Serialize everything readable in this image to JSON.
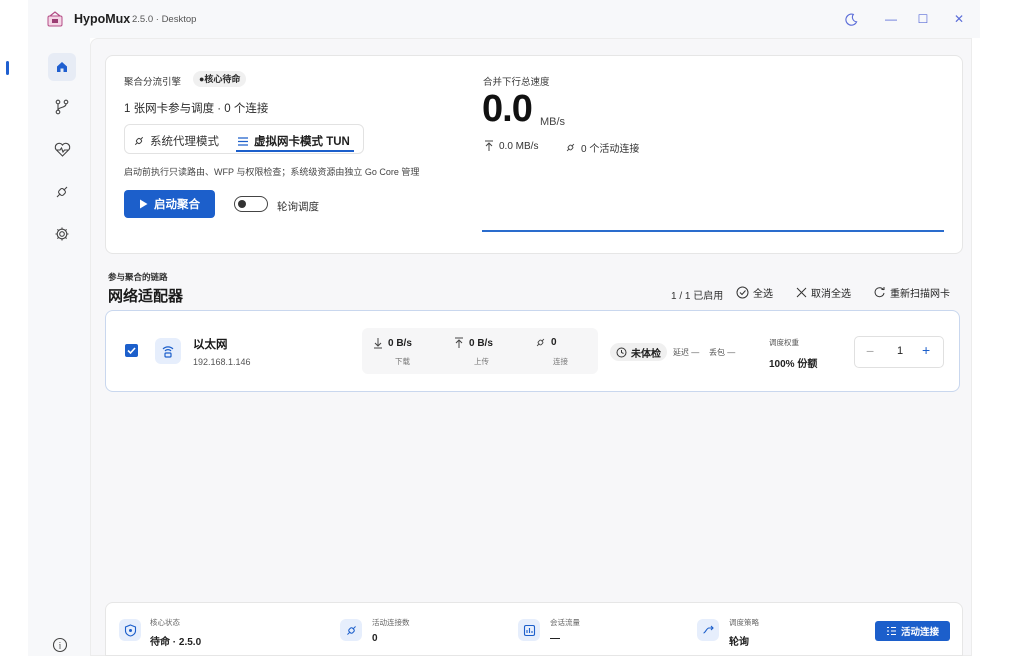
{
  "window": {
    "app_name": "HypoMux",
    "version": "2.5.0 · Desktop",
    "controls": {
      "theme": "moon-icon",
      "minimize": "—",
      "maximize": "☐",
      "close": "✕"
    }
  },
  "sidebar": {
    "items": [
      {
        "name": "home",
        "active": true
      },
      {
        "name": "routes"
      },
      {
        "name": "health"
      },
      {
        "name": "connections"
      },
      {
        "name": "settings"
      }
    ],
    "info": "i"
  },
  "engine": {
    "label": "聚合分流引擎",
    "badge": "●核心待命",
    "summary": "1 张网卡参与调度 · 0 个连接",
    "mode_proxy": "系统代理模式",
    "mode_tun": "虚拟网卡模式 TUN",
    "hint": "启动前执行只读路由、WFP 与权限检查；系统级资源由独立 Go Core 管理",
    "start_button": "启动聚合",
    "round_robin": "轮询调度"
  },
  "speed": {
    "label": "合并下行总速度",
    "value": "0.0",
    "unit": "MB/s",
    "upload": "0.0 MB/s",
    "active": "0 个活动连接"
  },
  "adapters": {
    "section_label": "参与聚合的链路",
    "title": "网络适配器",
    "enabled_count": "1 / 1 已启用",
    "select_all": "全选",
    "deselect_all": "取消全选",
    "rescan": "重新扫描网卡",
    "items": [
      {
        "name": "以太网",
        "ip": "192.168.1.146",
        "down_value": "0 B/s",
        "down_label": "下载",
        "up_value": "0 B/s",
        "up_label": "上传",
        "conn_value": "0",
        "conn_label": "连接",
        "health_badge": "未体检",
        "latency": "延迟 —",
        "loss": "丢包 —",
        "weight_label": "调度权重",
        "weight_value": "100% 份额",
        "stepper_value": "1"
      }
    ]
  },
  "footer": {
    "core_label": "核心状态",
    "core_value": "待命 · 2.5.0",
    "conn_label": "活动连接数",
    "conn_value": "0",
    "traffic_label": "会话流量",
    "traffic_value": "—",
    "policy_label": "调度策略",
    "policy_value": "轮询",
    "active_button": "活动连接"
  },
  "colors": {
    "accent": "#1c5fcb",
    "icon_tint": "#5b6dd8"
  }
}
